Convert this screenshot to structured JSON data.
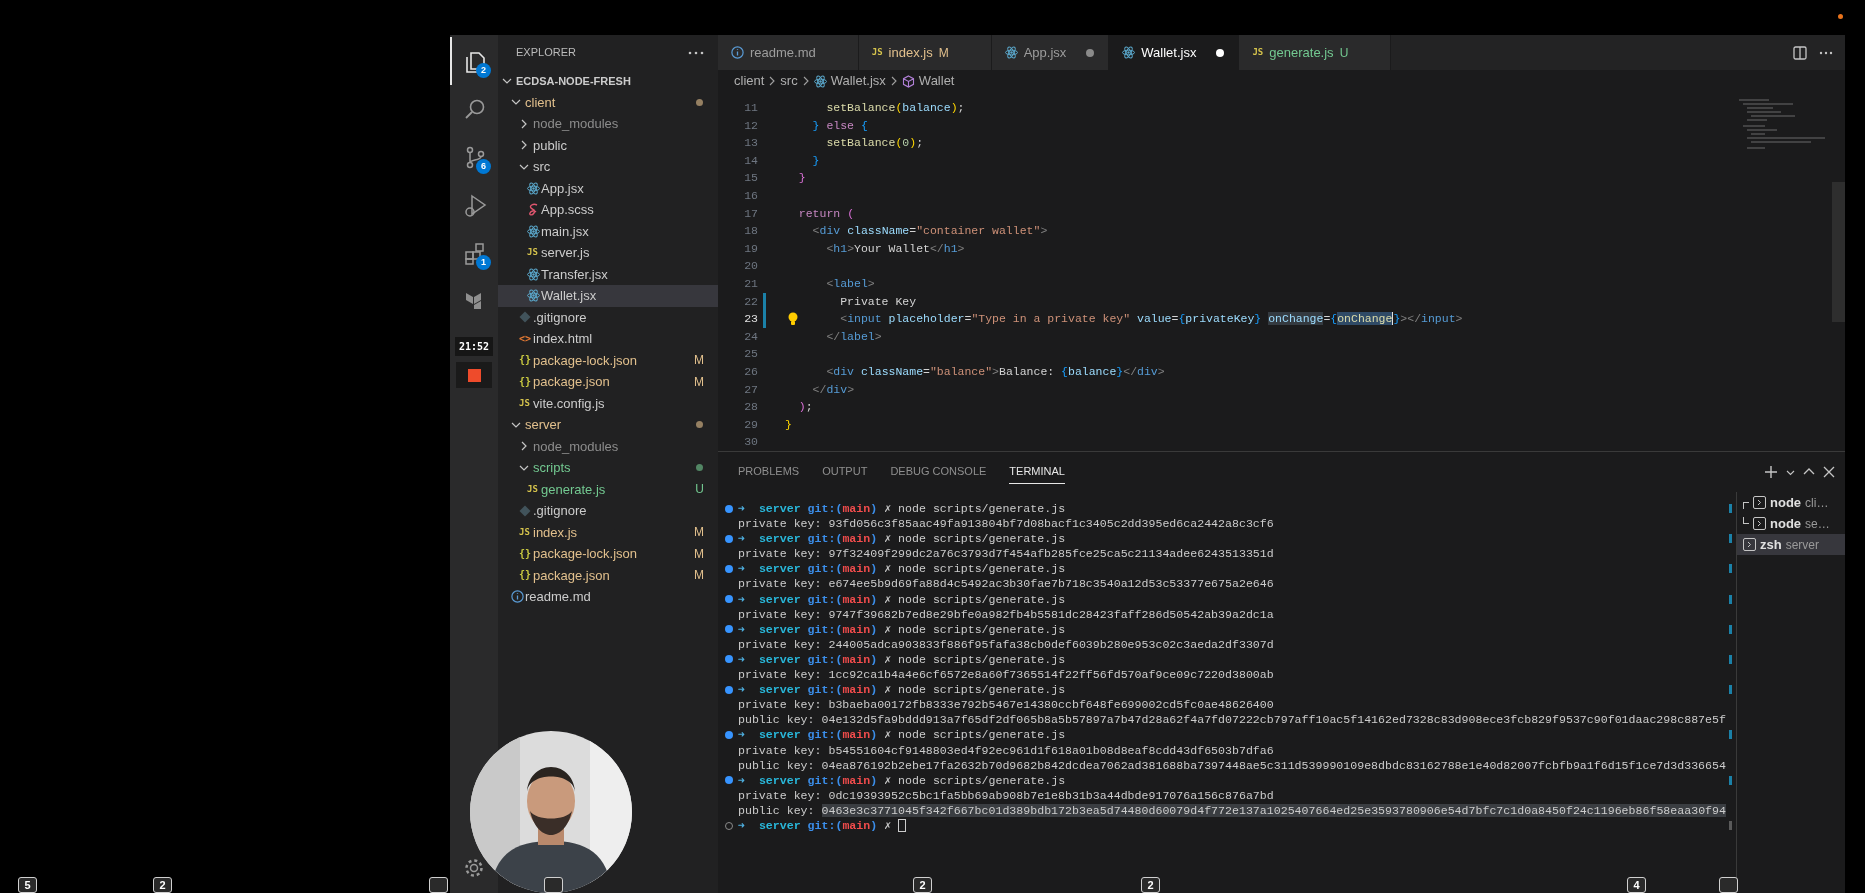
{
  "activity_bar": {
    "items": [
      {
        "kind": "files",
        "badge": "2",
        "selected": true
      },
      {
        "kind": "search",
        "selected": false
      },
      {
        "kind": "source-control",
        "badge": "6",
        "selected": false
      },
      {
        "kind": "run-debug",
        "selected": false
      },
      {
        "kind": "extensions",
        "badge": "1",
        "selected": false
      },
      {
        "kind": "terraform",
        "selected": false
      }
    ],
    "recording": {
      "time": "21:52"
    }
  },
  "sidebar": {
    "title": "EXPLORER",
    "root": {
      "name": "ECDSA-NODE-FRESH",
      "expanded": true,
      "children": [
        {
          "name": "client",
          "kind": "folder",
          "color": "#e2c08d",
          "dot": true,
          "expanded": true,
          "selected": false,
          "children": [
            {
              "name": "node_modules",
              "kind": "folder",
              "color": "#8c8c8c",
              "dot": false,
              "expanded": false,
              "selected": false
            },
            {
              "name": "public",
              "kind": "folder",
              "color": "#cccccc",
              "dot": false,
              "expanded": false,
              "selected": false
            },
            {
              "name": "src",
              "kind": "folder",
              "color": "#cccccc",
              "dot": false,
              "expanded": true,
              "selected": false,
              "children": [
                {
                  "name": "App.jsx",
                  "kind": "react",
                  "color": "#cccccc",
                  "selected": false
                },
                {
                  "name": "App.scss",
                  "kind": "sass",
                  "color": "#cccccc",
                  "selected": false
                },
                {
                  "name": "main.jsx",
                  "kind": "react",
                  "color": "#cccccc",
                  "selected": false
                },
                {
                  "name": "server.js",
                  "kind": "js",
                  "icon_label": "JS",
                  "color": "#cccccc",
                  "selected": false
                },
                {
                  "name": "Transfer.jsx",
                  "kind": "react",
                  "color": "#cccccc",
                  "selected": false
                },
                {
                  "name": "Wallet.jsx",
                  "kind": "react",
                  "color": "#cccccc",
                  "selected": true
                }
              ]
            },
            {
              "name": ".gitignore",
              "kind": "git",
              "color": "#cccccc",
              "selected": false
            },
            {
              "name": "index.html",
              "kind": "html",
              "icon_label": "<>",
              "color": "#cccccc",
              "selected": false
            },
            {
              "name": "package-lock.json",
              "kind": "json",
              "icon_label": "{}",
              "color": "#e2c08d",
              "badge": "M",
              "selected": false
            },
            {
              "name": "package.json",
              "kind": "json",
              "icon_label": "{}",
              "color": "#e2c08d",
              "badge": "M",
              "selected": false
            },
            {
              "name": "vite.config.js",
              "kind": "js",
              "icon_label": "JS",
              "color": "#cccccc",
              "selected": false
            }
          ]
        },
        {
          "name": "server",
          "kind": "folder",
          "color": "#e2c08d",
          "dot": true,
          "expanded": true,
          "selected": false,
          "children": [
            {
              "name": "node_modules",
              "kind": "folder",
              "color": "#8c8c8c",
              "dot": false,
              "expanded": false,
              "selected": false
            },
            {
              "name": "scripts",
              "kind": "folder",
              "color": "#73c991",
              "dot": true,
              "expanded": true,
              "selected": false,
              "children": [
                {
                  "name": "generate.js",
                  "kind": "js",
                  "icon_label": "JS",
                  "color": "#73c991",
                  "badge": "U",
                  "selected": false
                }
              ]
            },
            {
              "name": ".gitignore",
              "kind": "git",
              "color": "#cccccc",
              "selected": false
            },
            {
              "name": "index.js",
              "kind": "js",
              "icon_label": "JS",
              "color": "#e2c08d",
              "badge": "M",
              "selected": false
            },
            {
              "name": "package-lock.json",
              "kind": "json",
              "icon_label": "{}",
              "color": "#e2c08d",
              "badge": "M",
              "selected": false
            },
            {
              "name": "package.json",
              "kind": "json",
              "icon_label": "{}",
              "color": "#e2c08d",
              "badge": "M",
              "selected": false
            }
          ]
        },
        {
          "name": "readme.md",
          "kind": "info",
          "color": "#cccccc",
          "selected": false
        }
      ]
    }
  },
  "tabs": [
    {
      "label": "readme.md",
      "kind": "info",
      "color": "#9d9d9d",
      "dirty": false,
      "selected": false
    },
    {
      "label": "index.js",
      "kind": "js",
      "icon_label": "JS",
      "color": "#e2c08d",
      "badge": "M",
      "dirty": false,
      "selected": false
    },
    {
      "label": "App.jsx",
      "kind": "react",
      "color": "#9d9d9d",
      "dirty": true,
      "selected": false
    },
    {
      "label": "Wallet.jsx",
      "kind": "react",
      "color": "#ffffff",
      "dirty": true,
      "selected": true
    },
    {
      "label": "generate.js",
      "kind": "js",
      "icon_label": "JS",
      "color": "#73c991",
      "badge": "U",
      "dirty": false,
      "selected": false
    }
  ],
  "breadcrumb": [
    {
      "label": "client",
      "kind": "folder"
    },
    {
      "label": "src",
      "kind": "folder"
    },
    {
      "label": "Wallet.jsx",
      "kind": "react"
    },
    {
      "label": "Wallet",
      "kind": "component"
    }
  ],
  "editor": {
    "lines": [
      {
        "number": "11",
        "modified": false,
        "current": false,
        "lightbulb": false,
        "cursor": false,
        "tokens": [
          {
            "text": "      setBalance",
            "kind": "fn"
          },
          {
            "text": "(",
            "kind": "b1"
          },
          {
            "text": "balance",
            "kind": "var"
          },
          {
            "text": ")",
            "kind": "b1"
          },
          {
            "text": ";",
            "kind": "plain"
          }
        ]
      },
      {
        "number": "12",
        "modified": false,
        "current": false,
        "lightbulb": false,
        "cursor": false,
        "tokens": [
          {
            "text": "    }",
            "kind": "b3"
          },
          {
            "text": " else ",
            "kind": "kw"
          },
          {
            "text": "{",
            "kind": "b3"
          }
        ]
      },
      {
        "number": "13",
        "modified": false,
        "current": false,
        "lightbulb": false,
        "cursor": false,
        "tokens": [
          {
            "text": "      setBalance",
            "kind": "fn"
          },
          {
            "text": "(",
            "kind": "b1"
          },
          {
            "text": "0",
            "kind": "num"
          },
          {
            "text": ")",
            "kind": "b1"
          },
          {
            "text": ";",
            "kind": "plain"
          }
        ]
      },
      {
        "number": "14",
        "modified": false,
        "current": false,
        "lightbulb": false,
        "cursor": false,
        "tokens": [
          {
            "text": "    }",
            "kind": "b3"
          }
        ]
      },
      {
        "number": "15",
        "modified": false,
        "current": false,
        "lightbulb": false,
        "cursor": false,
        "tokens": [
          {
            "text": "  }",
            "kind": "b2"
          }
        ]
      },
      {
        "number": "16",
        "modified": false,
        "current": false,
        "lightbulb": false,
        "cursor": false
      },
      {
        "number": "17",
        "modified": false,
        "current": false,
        "lightbulb": false,
        "cursor": false,
        "tokens": [
          {
            "text": "  return ",
            "kind": "kw"
          },
          {
            "text": "(",
            "kind": "b2"
          }
        ]
      },
      {
        "number": "18",
        "modified": false,
        "current": false,
        "lightbulb": false,
        "cursor": false,
        "tokens": [
          {
            "text": "    <",
            "kind": "punct"
          },
          {
            "text": "div",
            "kind": "tag"
          },
          {
            "text": " className",
            "kind": "attr"
          },
          {
            "text": "=",
            "kind": "plain"
          },
          {
            "text": "\"container wallet\"",
            "kind": "str"
          },
          {
            "text": ">",
            "kind": "punct"
          }
        ]
      },
      {
        "number": "19",
        "modified": false,
        "current": false,
        "lightbulb": false,
        "cursor": false,
        "tokens": [
          {
            "text": "      <",
            "kind": "punct"
          },
          {
            "text": "h1",
            "kind": "tag"
          },
          {
            "text": ">",
            "kind": "punct"
          },
          {
            "text": "Your Wallet",
            "kind": "plain"
          },
          {
            "text": "</",
            "kind": "punct"
          },
          {
            "text": "h1",
            "kind": "tag"
          },
          {
            "text": ">",
            "kind": "punct"
          }
        ]
      },
      {
        "number": "20",
        "modified": false,
        "current": false,
        "lightbulb": false,
        "cursor": false
      },
      {
        "number": "21",
        "modified": false,
        "current": false,
        "lightbulb": false,
        "cursor": false,
        "tokens": [
          {
            "text": "      <",
            "kind": "punct"
          },
          {
            "text": "label",
            "kind": "tag"
          },
          {
            "text": ">",
            "kind": "punct"
          }
        ]
      },
      {
        "number": "22",
        "modified": true,
        "current": false,
        "lightbulb": false,
        "cursor": false,
        "tokens": [
          {
            "text": "        Private Key",
            "kind": "plain"
          }
        ]
      },
      {
        "number": "23",
        "modified": true,
        "current": true,
        "lightbulb": true,
        "cursor": true,
        "tokens": [
          {
            "text": "        <",
            "kind": "punct"
          },
          {
            "text": "input",
            "kind": "tag"
          },
          {
            "text": " placeholder",
            "kind": "attr"
          },
          {
            "text": "=",
            "kind": "plain"
          },
          {
            "text": "\"Type in a private key\"",
            "kind": "str"
          },
          {
            "text": " value",
            "kind": "attr"
          },
          {
            "text": "=",
            "kind": "plain"
          },
          {
            "text": "{",
            "kind": "b3"
          },
          {
            "text": "privateKey",
            "kind": "var"
          },
          {
            "text": "} ",
            "kind": "b3"
          },
          {
            "text": "onChange",
            "kind": "hl"
          },
          {
            "text": "=",
            "kind": "plain"
          },
          {
            "text": "{",
            "kind": "b3"
          },
          {
            "text": "onChange",
            "kind": "sel"
          },
          {
            "text": "}",
            "kind": "b3"
          },
          {
            "text": "></",
            "kind": "punct"
          },
          {
            "text": "input",
            "kind": "tag"
          },
          {
            "text": ">",
            "kind": "punct"
          }
        ]
      },
      {
        "number": "24",
        "modified": false,
        "current": false,
        "lightbulb": false,
        "cursor": false,
        "tokens": [
          {
            "text": "      </",
            "kind": "punct"
          },
          {
            "text": "label",
            "kind": "tag"
          },
          {
            "text": ">",
            "kind": "punct"
          }
        ]
      },
      {
        "number": "25",
        "modified": false,
        "current": false,
        "lightbulb": false,
        "cursor": false
      },
      {
        "number": "26",
        "modified": false,
        "current": false,
        "lightbulb": false,
        "cursor": false,
        "tokens": [
          {
            "text": "      <",
            "kind": "punct"
          },
          {
            "text": "div",
            "kind": "tag"
          },
          {
            "text": " className",
            "kind": "attr"
          },
          {
            "text": "=",
            "kind": "plain"
          },
          {
            "text": "\"balance\"",
            "kind": "str"
          },
          {
            "text": ">",
            "kind": "punct"
          },
          {
            "text": "Balance: ",
            "kind": "plain"
          },
          {
            "text": "{",
            "kind": "b3"
          },
          {
            "text": "balance",
            "kind": "var"
          },
          {
            "text": "}",
            "kind": "b3"
          },
          {
            "text": "</",
            "kind": "punct"
          },
          {
            "text": "div",
            "kind": "tag"
          },
          {
            "text": ">",
            "kind": "punct"
          }
        ]
      },
      {
        "number": "27",
        "modified": false,
        "current": false,
        "lightbulb": false,
        "cursor": false,
        "tokens": [
          {
            "text": "    </",
            "kind": "punct"
          },
          {
            "text": "div",
            "kind": "tag"
          },
          {
            "text": ">",
            "kind": "punct"
          }
        ]
      },
      {
        "number": "28",
        "modified": false,
        "current": false,
        "lightbulb": false,
        "cursor": false,
        "tokens": [
          {
            "text": "  )",
            "kind": "b2"
          },
          {
            "text": ";",
            "kind": "plain"
          }
        ]
      },
      {
        "number": "29",
        "modified": false,
        "current": false,
        "lightbulb": false,
        "cursor": false,
        "tokens": [
          {
            "text": "}",
            "kind": "b1"
          }
        ]
      },
      {
        "number": "30",
        "modified": false,
        "current": false,
        "lightbulb": false,
        "cursor": false
      }
    ]
  },
  "panel": {
    "tabs": [
      {
        "label": "PROBLEMS",
        "selected": false
      },
      {
        "label": "OUTPUT",
        "selected": false
      },
      {
        "label": "DEBUG CONSOLE",
        "selected": false
      },
      {
        "label": "TERMINAL",
        "selected": true
      }
    ],
    "terminal": {
      "lines": [
        {
          "kind": "prompt",
          "done": true,
          "cursor": false,
          "tokens": [
            {
              "text": "➜",
              "kind": "arrow"
            },
            {
              "text": "  server",
              "kind": "dir"
            },
            {
              "text": " git:(",
              "kind": "git"
            },
            {
              "text": "main",
              "kind": "branch"
            },
            {
              "text": ")",
              "kind": "git"
            },
            {
              "text": " ✗",
              "kind": "mark"
            },
            {
              "text": " node scripts/generate.js",
              "kind": "plain"
            }
          ]
        },
        {
          "kind": "output",
          "tokens": [
            {
              "text": "private key: 93fd056c3f85aac49fa913804bf7d08bacf1c3405c2dd395ed6ca2442a8c3cf6",
              "kind": "plain"
            }
          ]
        },
        {
          "kind": "prompt",
          "done": true,
          "cursor": false,
          "tokens": [
            {
              "text": "➜",
              "kind": "arrow"
            },
            {
              "text": "  server",
              "kind": "dir"
            },
            {
              "text": " git:(",
              "kind": "git"
            },
            {
              "text": "main",
              "kind": "branch"
            },
            {
              "text": ")",
              "kind": "git"
            },
            {
              "text": " ✗",
              "kind": "mark"
            },
            {
              "text": " node scripts/generate.js",
              "kind": "plain"
            }
          ]
        },
        {
          "kind": "output",
          "tokens": [
            {
              "text": "private key: 97f32409f299dc2a76c3793d7f454afb285fce25ca5c21134adee6243513351d",
              "kind": "plain"
            }
          ]
        },
        {
          "kind": "prompt",
          "done": true,
          "cursor": false,
          "tokens": [
            {
              "text": "➜",
              "kind": "arrow"
            },
            {
              "text": "  server",
              "kind": "dir"
            },
            {
              "text": " git:(",
              "kind": "git"
            },
            {
              "text": "main",
              "kind": "branch"
            },
            {
              "text": ")",
              "kind": "git"
            },
            {
              "text": " ✗",
              "kind": "mark"
            },
            {
              "text": " node scripts/generate.js",
              "kind": "plain"
            }
          ]
        },
        {
          "kind": "output",
          "tokens": [
            {
              "text": "private key: e674ee5b9d69fa88d4c5492ac3b30fae7b718c3540a12d53c53377e675a2e646",
              "kind": "plain"
            }
          ]
        },
        {
          "kind": "prompt",
          "done": true,
          "cursor": false,
          "tokens": [
            {
              "text": "➜",
              "kind": "arrow"
            },
            {
              "text": "  server",
              "kind": "dir"
            },
            {
              "text": " git:(",
              "kind": "git"
            },
            {
              "text": "main",
              "kind": "branch"
            },
            {
              "text": ")",
              "kind": "git"
            },
            {
              "text": " ✗",
              "kind": "mark"
            },
            {
              "text": " node scripts/generate.js",
              "kind": "plain"
            }
          ]
        },
        {
          "kind": "output",
          "tokens": [
            {
              "text": "private key: 9747f39682b7ed8e29bfe0a982fb4b5581dc28423faff286d50542ab39a2dc1a",
              "kind": "plain"
            }
          ]
        },
        {
          "kind": "prompt",
          "done": true,
          "cursor": false,
          "tokens": [
            {
              "text": "➜",
              "kind": "arrow"
            },
            {
              "text": "  server",
              "kind": "dir"
            },
            {
              "text": " git:(",
              "kind": "git"
            },
            {
              "text": "main",
              "kind": "branch"
            },
            {
              "text": ")",
              "kind": "git"
            },
            {
              "text": " ✗",
              "kind": "mark"
            },
            {
              "text": " node scripts/generate.js",
              "kind": "plain"
            }
          ]
        },
        {
          "kind": "output",
          "tokens": [
            {
              "text": "private key: 244005adca903833f886f95fafa38cb0def6039b280e953c02c3aeda2df3307d",
              "kind": "plain"
            }
          ]
        },
        {
          "kind": "prompt",
          "done": true,
          "cursor": false,
          "tokens": [
            {
              "text": "➜",
              "kind": "arrow"
            },
            {
              "text": "  server",
              "kind": "dir"
            },
            {
              "text": " git:(",
              "kind": "git"
            },
            {
              "text": "main",
              "kind": "branch"
            },
            {
              "text": ")",
              "kind": "git"
            },
            {
              "text": " ✗",
              "kind": "mark"
            },
            {
              "text": " node scripts/generate.js",
              "kind": "plain"
            }
          ]
        },
        {
          "kind": "output",
          "tokens": [
            {
              "text": "private key: 1cc92ca1b4a4e6cf6572e8a60f7365514f22ff56fd570af9ce09c7220d3800ab",
              "kind": "plain"
            }
          ]
        },
        {
          "kind": "prompt",
          "done": true,
          "cursor": false,
          "tokens": [
            {
              "text": "➜",
              "kind": "arrow"
            },
            {
              "text": "  server",
              "kind": "dir"
            },
            {
              "text": " git:(",
              "kind": "git"
            },
            {
              "text": "main",
              "kind": "branch"
            },
            {
              "text": ")",
              "kind": "git"
            },
            {
              "text": " ✗",
              "kind": "mark"
            },
            {
              "text": " node scripts/generate.js",
              "kind": "plain"
            }
          ]
        },
        {
          "kind": "output",
          "tokens": [
            {
              "text": "private key: b3baeba00172fb8333e792b5467e14380ccbf648fe699002cd5fc0ae48626400",
              "kind": "plain"
            }
          ]
        },
        {
          "kind": "output",
          "tokens": [
            {
              "text": "public key: 04e132d5fa9bddd913a7f65df2df065b8a5b57897a7b47d28a62f4a7fd07222cb797aff10ac5f14162ed7328c83d908ece3fcb829f9537c90f01daac298c887e5f",
              "kind": "plain"
            }
          ]
        },
        {
          "kind": "prompt",
          "done": true,
          "cursor": false,
          "tokens": [
            {
              "text": "➜",
              "kind": "arrow"
            },
            {
              "text": "  server",
              "kind": "dir"
            },
            {
              "text": " git:(",
              "kind": "git"
            },
            {
              "text": "main",
              "kind": "branch"
            },
            {
              "text": ")",
              "kind": "git"
            },
            {
              "text": " ✗",
              "kind": "mark"
            },
            {
              "text": " node scripts/generate.js",
              "kind": "plain"
            }
          ]
        },
        {
          "kind": "output",
          "tokens": [
            {
              "text": "private key: b54551604cf9148803ed4f92ec961d1f618a01b08d8eaf8cdd43df6503b7dfa6",
              "kind": "plain"
            }
          ]
        },
        {
          "kind": "output",
          "tokens": [
            {
              "text": "public key: 04ea876192b2ebe17fa2632b70d9682b842dcdea7062ad381688ba7397448ae5c311d539990109e8dbdc83162788e1e40d82007fcbfb9a1f6d15f1ce7d3d336654",
              "kind": "plain"
            }
          ]
        },
        {
          "kind": "prompt",
          "done": true,
          "cursor": false,
          "tokens": [
            {
              "text": "➜",
              "kind": "arrow"
            },
            {
              "text": "  server",
              "kind": "dir"
            },
            {
              "text": " git:(",
              "kind": "git"
            },
            {
              "text": "main",
              "kind": "branch"
            },
            {
              "text": ")",
              "kind": "git"
            },
            {
              "text": " ✗",
              "kind": "mark"
            },
            {
              "text": " node scripts/generate.js",
              "kind": "plain"
            }
          ]
        },
        {
          "kind": "output",
          "tokens": [
            {
              "text": "private key: 0dc19393952c5bc1fa5bb69ab908b7e1e8b31b3a44dbde917076a156c876a7bd",
              "kind": "plain"
            }
          ]
        },
        {
          "kind": "output",
          "tokens": [
            {
              "text": "public key: ",
              "kind": "plain"
            },
            {
              "text": "0463e3c3771045f342f667bc01d389bdb172b3ea5d74480d60079d4f772e137a1025407664ed25e3593780906e54d7bfc7c1d0a8450f24c1196eb86f58eaa30f94",
              "kind": "selected"
            }
          ]
        },
        {
          "kind": "prompt",
          "done": false,
          "cursor": true,
          "tokens": [
            {
              "text": "➜",
              "kind": "arrow"
            },
            {
              "text": "  server",
              "kind": "dir"
            },
            {
              "text": " git:(",
              "kind": "git"
            },
            {
              "text": "main",
              "kind": "branch"
            },
            {
              "text": ")",
              "kind": "git"
            },
            {
              "text": " ✗",
              "kind": "mark"
            }
          ]
        }
      ]
    },
    "sessions": [
      {
        "name": "node",
        "detail": "cli…",
        "kind": "split-start",
        "selected": false
      },
      {
        "name": "node",
        "detail": "se…",
        "kind": "split-end",
        "selected": false
      },
      {
        "name": "zsh",
        "detail": "server",
        "kind": "single",
        "selected": true
      }
    ]
  },
  "overlay_badges": [
    {
      "kind": "number",
      "label": "5"
    },
    {
      "kind": "number",
      "label": "2"
    },
    {
      "kind": "blank"
    },
    {
      "kind": "blank"
    },
    {
      "kind": "number",
      "label": "2"
    },
    {
      "kind": "number",
      "label": "2"
    },
    {
      "kind": "number",
      "label": "4"
    },
    {
      "kind": "blank"
    }
  ]
}
